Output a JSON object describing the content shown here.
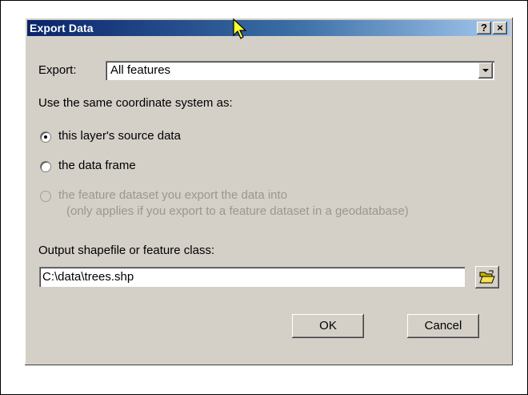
{
  "window": {
    "title": "Export Data",
    "help_button": "?",
    "close_button": "×"
  },
  "export": {
    "label": "Export:",
    "selected": "All features"
  },
  "coordinate_system": {
    "heading": "Use the same coordinate system as:",
    "options": [
      {
        "label": "this layer's source data",
        "selected": true,
        "enabled": true
      },
      {
        "label": "the data frame",
        "selected": false,
        "enabled": true
      },
      {
        "label": "the feature dataset you export the data into",
        "note": "(only applies if you export to a feature dataset in a geodatabase)",
        "selected": false,
        "enabled": false
      }
    ]
  },
  "output": {
    "label": "Output shapefile or feature class:",
    "value": "C:\\data\\trees.shp"
  },
  "buttons": {
    "ok": "OK",
    "cancel": "Cancel"
  },
  "icons": {
    "browse": "open-folder-icon",
    "cursor": "mouse-pointer-icon"
  }
}
